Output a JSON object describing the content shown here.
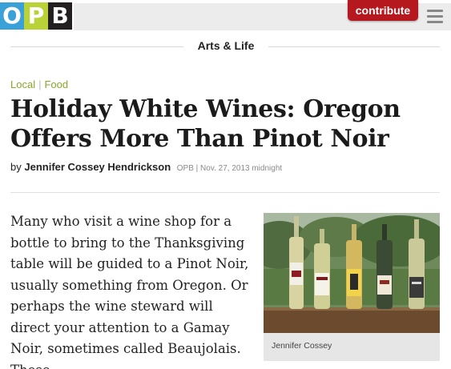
{
  "header": {
    "logo": [
      "O",
      "P",
      "B"
    ],
    "contribute_label": "contribute",
    "menu_icon": "hamburger-menu-icon"
  },
  "section": {
    "title": "Arts & Life"
  },
  "categories": [
    "Local",
    "Food"
  ],
  "article": {
    "title": "Holiday White Wines: Oregon Offers More Than Pinot Noir",
    "byline_prefix": "by",
    "author": "Jennifer Cossey Hendrickson",
    "meta": "OPB | Nov. 27, 2013 midnight",
    "body": "Many who visit a wine shop for a bottle to bring to the Thanksgiving table will be guided to a Pinot Noir, usually something from Oregon. Or perhaps the wine steward will direct your attention to a Gamay Noir, sometimes called Beaujolais. These",
    "image_caption": "Jennifer Cossey"
  },
  "colors": {
    "brand_red": "#b5191f",
    "category_green": "#8aa62c",
    "logo_blue": "#3aa0d8",
    "logo_green": "#b8d237",
    "logo_black": "#231f20"
  }
}
